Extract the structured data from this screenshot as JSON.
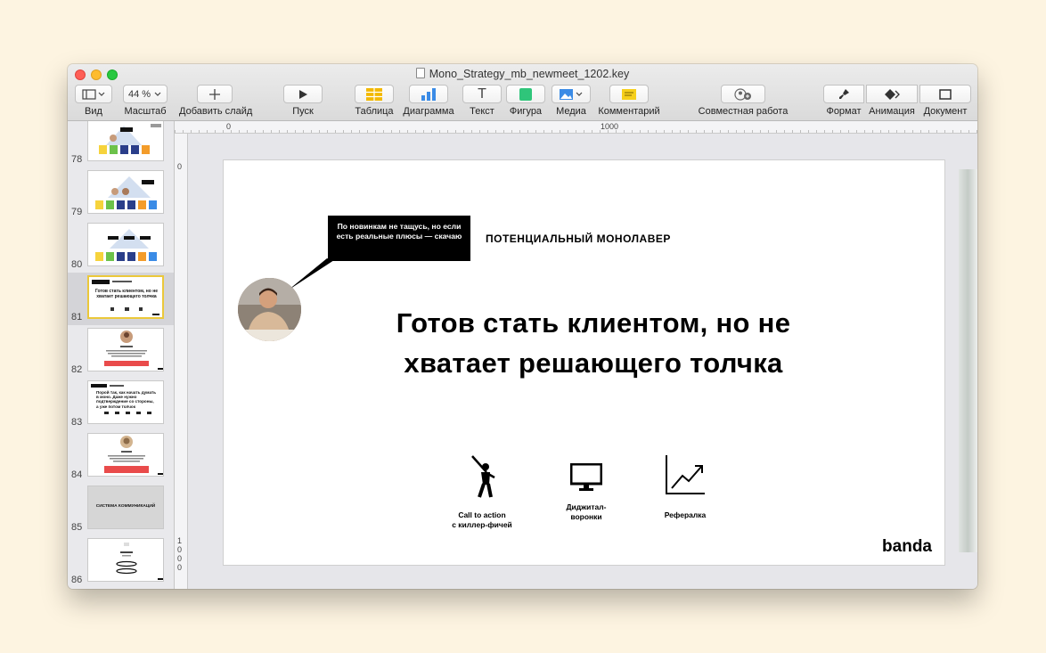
{
  "window": {
    "title": "Mono_Strategy_mb_newmeet_1202.key"
  },
  "toolbar": {
    "view_label": "Вид",
    "zoom_value": "44 %",
    "zoom_label": "Масштаб",
    "add_slide_label": "Добавить слайд",
    "play_label": "Пуск",
    "table_label": "Таблица",
    "chart_label": "Диаграмма",
    "text_icon": "T",
    "text_label": "Текст",
    "shape_label": "Фигура",
    "media_label": "Медиа",
    "comment_label": "Комментарий",
    "collab_label": "Совместная работа",
    "format_label": "Формат",
    "animate_label": "Анимация",
    "document_label": "Документ"
  },
  "rulers": {
    "top_marks": [
      "0",
      "1000"
    ],
    "left_marks": [
      "0",
      "1",
      "0",
      "0",
      "0"
    ]
  },
  "navigator": {
    "slides": [
      {
        "num": "78",
        "text": ""
      },
      {
        "num": "79",
        "text": ""
      },
      {
        "num": "80",
        "text": ""
      },
      {
        "num": "81",
        "text": "Готов стать клиентом, но не хватает решающего толчка"
      },
      {
        "num": "82",
        "text": ""
      },
      {
        "num": "83",
        "text": "Порой так, как начать думать в моно. Даже нужно подтверждение со стороны, а уже потом толчок"
      },
      {
        "num": "84",
        "text": ""
      },
      {
        "num": "85",
        "text": "СИСТЕМА КОММУНИКАЦИЙ"
      },
      {
        "num": "86",
        "text": ""
      }
    ]
  },
  "slide": {
    "bubble_text": "По новинкам  не тащусь, но если есть реальные плюсы — скачаю",
    "section_title": "ПОТЕНЦИАЛЬНЫЙ МОНОЛАВЕР",
    "headline_line1": "Готов стать клиентом, но не",
    "headline_line2": "хватает решающего толчка",
    "features": [
      {
        "icon": "golfer-icon",
        "line1": "Call to action",
        "line2": "с киллер-фичей"
      },
      {
        "icon": "monitor-icon",
        "line1": "Диджитал-",
        "line2": "воронки"
      },
      {
        "icon": "growth-chart-icon",
        "line1": "Рефералка",
        "line2": ""
      }
    ],
    "brand": "banda"
  },
  "colors": {
    "background": "#fdf4e1",
    "selection_border": "#ebc83a",
    "thumb_red": "#e94b4b",
    "thumb_yellow": "#f6d33c"
  }
}
